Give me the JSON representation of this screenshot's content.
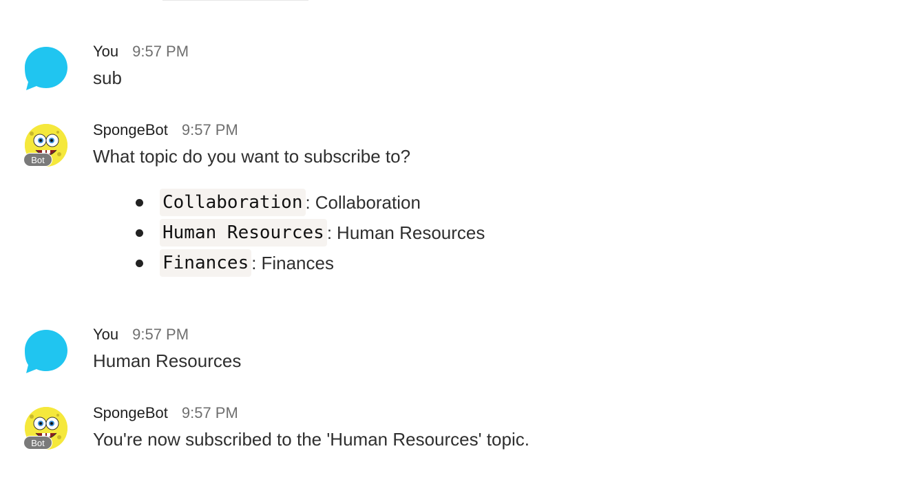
{
  "messages": [
    {
      "sender": "You",
      "time": "9:57 PM",
      "text": "sub",
      "avatar_icon": "chat-bubble-icon"
    },
    {
      "sender": "SpongeBot",
      "time": "9:57 PM",
      "text": "What topic do you want to subscribe to?",
      "badge": "Bot",
      "avatar_icon": "spongebob-avatar-icon",
      "topics": [
        {
          "code": "Collaboration",
          "sep": ":",
          "desc": "Collaboration"
        },
        {
          "code": "Human Resources",
          "sep": ":",
          "desc": "Human Resources"
        },
        {
          "code": "Finances",
          "sep": ":",
          "desc": "Finances"
        }
      ]
    },
    {
      "sender": "You",
      "time": "9:57 PM",
      "text": "Human Resources",
      "avatar_icon": "chat-bubble-icon"
    },
    {
      "sender": "SpongeBot",
      "time": "9:57 PM",
      "text": "You're now subscribed to the 'Human Resources' topic.",
      "badge": "Bot",
      "avatar_icon": "spongebob-avatar-icon"
    }
  ],
  "colors": {
    "user_avatar": "#20c5f0",
    "bot_badge": "#7a7a7a",
    "code_bg": "#f6f3f0",
    "sponge_yellow": "#f5e83c"
  }
}
